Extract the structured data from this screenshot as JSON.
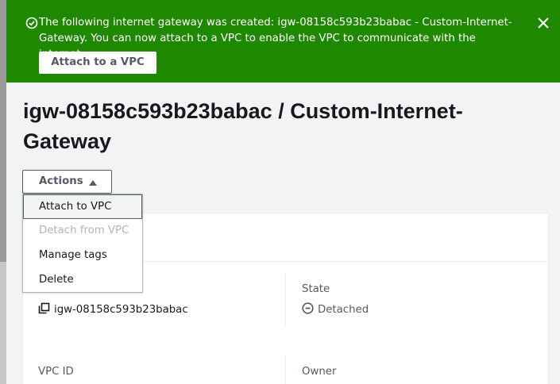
{
  "flash": {
    "message": "The following internet gateway was created: igw-08158c593b23babac - Custom-Internet-Gateway. You can now attach to a VPC to enable the VPC to communicate with the internet.",
    "attach_button": "Attach to a VPC",
    "status_color": "#1e8900",
    "icons": [
      "success-icon",
      "close-icon"
    ]
  },
  "page": {
    "title": "igw-08158c593b23babac / Custom-Internet-Gateway"
  },
  "actions": {
    "label": "Actions",
    "menu_open": true,
    "items": [
      {
        "label": "Attach to VPC",
        "enabled": true,
        "highlighted": true
      },
      {
        "label": "Detach from VPC",
        "enabled": false
      },
      {
        "label": "Manage tags",
        "enabled": true
      },
      {
        "label": "Delete",
        "enabled": true
      }
    ]
  },
  "details": {
    "internet_gateway_id": "igw-08158c593b23babac",
    "state_label": "State",
    "state_value": "Detached",
    "vpc_id_label": "VPC ID",
    "owner_label": "Owner"
  }
}
